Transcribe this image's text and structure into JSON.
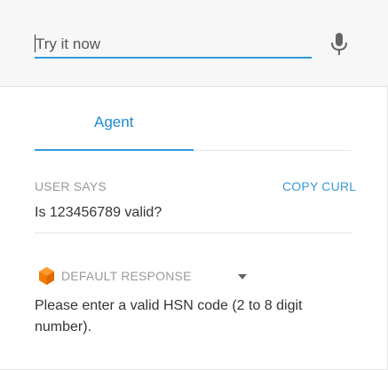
{
  "try_bar": {
    "placeholder": "Try it now",
    "mic_icon": "microphone-icon"
  },
  "tabs": [
    {
      "label": "Agent",
      "active": true
    }
  ],
  "user_says": {
    "label": "USER SAYS",
    "copy_curl_label": "COPY CURL",
    "query": "Is 123456789 valid?"
  },
  "response": {
    "icon": "cube-icon",
    "label": "DEFAULT RESPONSE",
    "dropdown_icon": "caret-down-icon",
    "text": "Please enter a valid HSN code (2 to 8 digit number)."
  },
  "colors": {
    "accent": "#2e9ad9",
    "link": "#3a9ad6",
    "muted": "#9a9a9a",
    "response_icon": "#f57c00"
  }
}
